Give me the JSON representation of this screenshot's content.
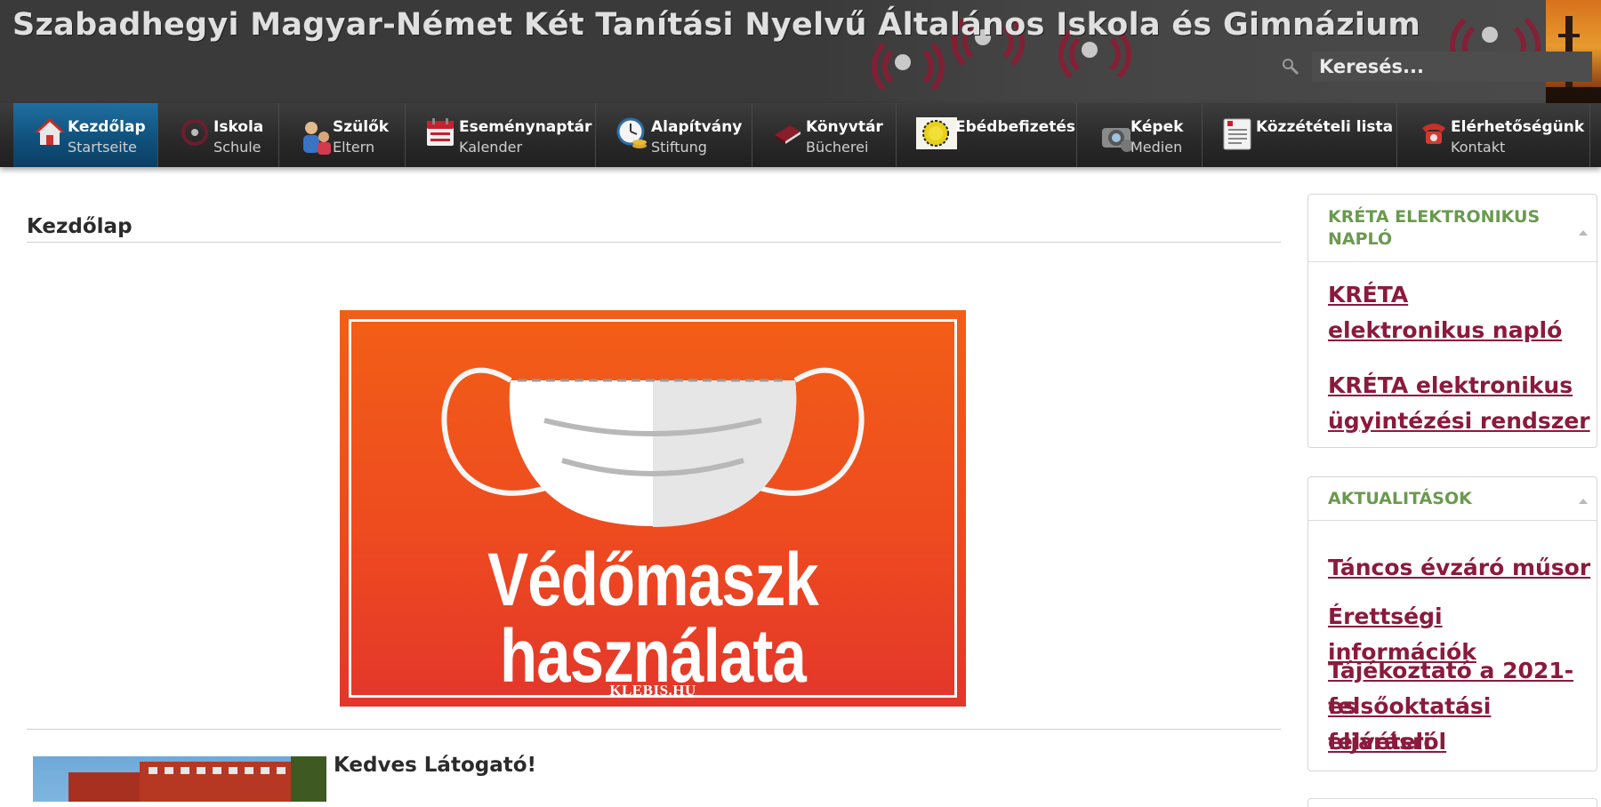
{
  "header": {
    "site_title": "Szabadhegyi Magyar-Német Két Tanítási Nyelvű Általános Iskola és Gimnázium",
    "search_placeholder": "Keresés..."
  },
  "nav": {
    "items": [
      {
        "label": "Kezdőlap",
        "sub": "Startseite",
        "icon": "home-icon",
        "active": true
      },
      {
        "label": "Iskola",
        "sub": "Schule",
        "icon": "school-icon"
      },
      {
        "label": "Szülők",
        "sub": "Eltern",
        "icon": "parents-icon"
      },
      {
        "label": "Eseménynaptár",
        "sub": "Kalender",
        "icon": "calendar-icon"
      },
      {
        "label": "Alapítvány",
        "sub": "Stiftung",
        "icon": "foundation-icon"
      },
      {
        "label": "Könyvtár",
        "sub": "Bücherei",
        "icon": "library-icon"
      },
      {
        "label": "Ebédbefizetés",
        "sub": "",
        "icon": "lunch-payment-icon"
      },
      {
        "label": "Képek",
        "sub": "Medien",
        "icon": "camera-icon"
      },
      {
        "label": "Közzétételi lista",
        "sub": "",
        "icon": "document-list-icon"
      },
      {
        "label": "Elérhetőségünk",
        "sub": "Kontakt",
        "icon": "phone-icon"
      }
    ]
  },
  "main": {
    "page_title": "Kezdőlap",
    "banner": {
      "line1": "Védőmaszk",
      "line2": "használata kötelező!",
      "credit": "KLEBIS.HU"
    },
    "welcome_title": "Kedves Látogató!"
  },
  "sidebar": {
    "kreta": {
      "title_line1": "KRÉTA ELEKTRONIKUS",
      "title_line2": "NAPLÓ",
      "links": [
        {
          "line1": "KRÉTA",
          "line2": "elektronikus napló"
        },
        {
          "line1": "KRÉTA elektronikus",
          "line2": "ügyintézési rendszer"
        }
      ]
    },
    "news": {
      "title": "AKTUALITÁSOK",
      "links": [
        {
          "line1": "Táncos évzáró műsor"
        },
        {
          "line1": "Érettségi információk"
        },
        {
          "line1": "Tájékoztató a 2021-es",
          "line2": "felsőoktatási felvételi",
          "line3": "eljárásról"
        }
      ]
    }
  },
  "colors": {
    "header_bg": "#3a3a3a",
    "nav_active": "#1a6496",
    "link": "#8b1a3c",
    "panel_title": "#6a9a4e",
    "banner_orange": "#ef4f1e"
  }
}
